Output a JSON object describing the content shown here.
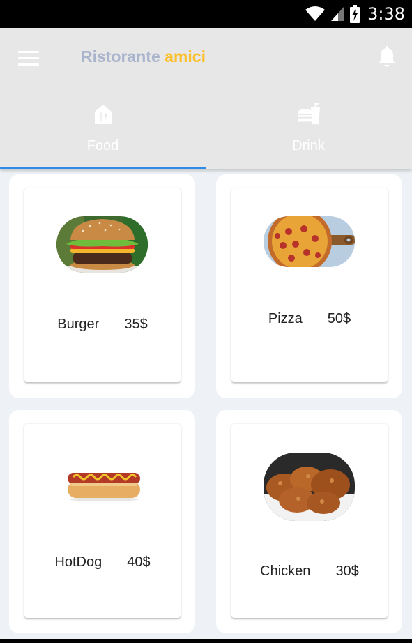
{
  "status_bar": {
    "time": "3:38"
  },
  "app_bar": {
    "title_part1": "Ristorante",
    "title_part2": "amici"
  },
  "tabs": [
    {
      "label": "Food",
      "icon": "restaurant-icon",
      "active": true
    },
    {
      "label": "Drink",
      "icon": "fastfood-icon",
      "active": false
    }
  ],
  "items": [
    {
      "name": "Burger",
      "price": "35$",
      "image": "burger-image"
    },
    {
      "name": "Pizza",
      "price": "50$",
      "image": "pizza-image"
    },
    {
      "name": "HotDog",
      "price": "40$",
      "image": "hotdog-image"
    },
    {
      "name": "Chicken",
      "price": "30$",
      "image": "chicken-image"
    }
  ],
  "colors": {
    "title_part1": "#aab4cc",
    "title_part2": "#fbc02d",
    "tab_indicator": "#2e8be8",
    "app_bar": "#e7e7e7"
  }
}
